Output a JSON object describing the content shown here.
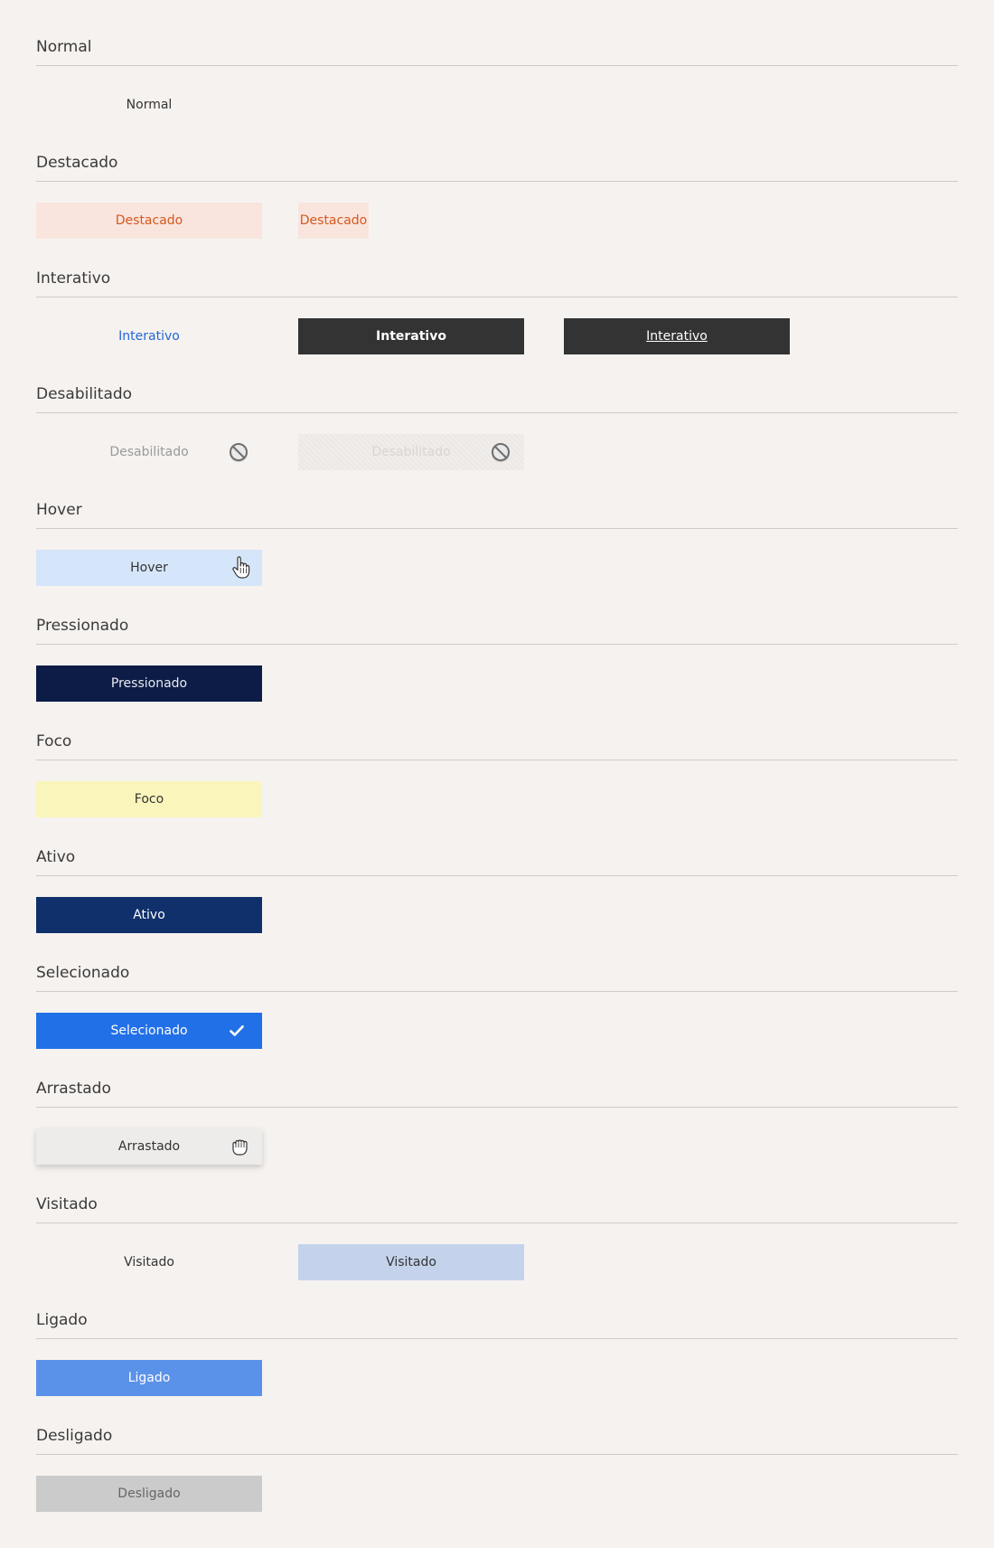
{
  "sections": [
    {
      "title": "Normal",
      "buttons": [
        "Normal"
      ]
    },
    {
      "title": "Destacado",
      "buttons": [
        "Destacado",
        "Destacado"
      ]
    },
    {
      "title": "Interativo",
      "buttons": [
        "Interativo",
        "Interativo",
        "Interativo"
      ]
    },
    {
      "title": "Desabilitado",
      "buttons": [
        "Desabilitado",
        "Desabilitado"
      ]
    },
    {
      "title": "Hover",
      "buttons": [
        "Hover"
      ]
    },
    {
      "title": "Pressionado",
      "buttons": [
        "Pressionado"
      ]
    },
    {
      "title": "Foco",
      "buttons": [
        "Foco"
      ]
    },
    {
      "title": "Ativo",
      "buttons": [
        "Ativo"
      ]
    },
    {
      "title": "Selecionado",
      "buttons": [
        "Selecionado"
      ]
    },
    {
      "title": "Arrastado",
      "buttons": [
        "Arrastado"
      ]
    },
    {
      "title": "Visitado",
      "buttons": [
        "Visitado",
        "Visitado"
      ]
    },
    {
      "title": "Ligado",
      "buttons": [
        "Ligado"
      ]
    },
    {
      "title": "Desligado",
      "buttons": [
        "Desligado"
      ]
    }
  ],
  "icons": {
    "disabled": "disabled-icon",
    "hover_cursor": "hand-pointer-icon",
    "selected": "checkmark-icon",
    "drag_cursor": "grab-hand-icon"
  },
  "colors": {
    "background": "#f6f2ef",
    "highlight_text": "#d4581f",
    "highlight_bg": "#f9e5de",
    "interactive_link": "#2267d6",
    "interactive_dark": "#333333",
    "hover_bg": "#d5e5fa",
    "pressed_bg": "#0c1c46",
    "focus_bg": "#faf6bb",
    "active_bg": "#0f306b",
    "selected_bg": "#2270e8",
    "visited_bg": "#c4d3eb",
    "on_bg": "#5b92e9",
    "off_bg": "#cbcbcb"
  }
}
